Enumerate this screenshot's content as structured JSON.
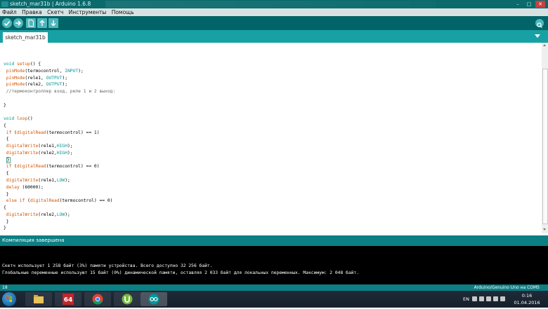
{
  "window": {
    "title": "sketch_mar31b | Arduino 1.6.8",
    "buttons": [
      "–",
      "□",
      "✕"
    ]
  },
  "menu": [
    "Файл",
    "Правка",
    "Скетч",
    "Инструменты",
    "Помощь"
  ],
  "toolbar": {
    "buttons": [
      "verify-icon",
      "upload-icon",
      "new-icon",
      "open-icon",
      "save-icon"
    ],
    "serial_monitor": "serial-monitor-icon"
  },
  "tabs": [
    {
      "label": "sketch_mar31b"
    }
  ],
  "editor": {
    "lines": [
      "void setup() {",
      " pinMode(termocontrol, INPUT);",
      " pinMode(rele1, OUTPUT);",
      " pinMode(rele2, OUTPUT);",
      " //термоконтроллер вход, реле 1 и 2 выход:",
      "",
      "}",
      "",
      "void loop()",
      "{",
      " if (digitalRead(termocontrol) == 1)",
      " {",
      " digitalWrite(rele1,HIGH);",
      " digitalWrite(rele2,HIGH);",
      " }",
      " if (digitalRead(termocontrol) == 0)",
      " {",
      " digitalWrite(rele1,LOW);",
      " delay (60000);",
      " }",
      " else if (digitalRead(termocontrol) == 0)",
      "{",
      " digitalWrite(rele2,LOW);",
      " }",
      "}"
    ]
  },
  "status": {
    "message": "Компиляция завершена"
  },
  "console": {
    "lines": [
      "Скетч использует 1 258 байт (3%) памяти устройства. Всего доступно 32 256 байт.",
      "Глобальные переменные используют 15 байт (0%) динамической памяти, оставляя 2 033 байт для локальных переменных. Максимум: 2 048 байт."
    ]
  },
  "infobar": {
    "line": "18",
    "board": "Arduino/Genuino Uno на COM5"
  },
  "taskbar": {
    "apps": [
      "explorer-icon",
      "aida64-icon",
      "chrome-icon",
      "utorrent-icon",
      "arduino-icon"
    ],
    "badge_64": "64",
    "language": "EN",
    "time": "0:16",
    "date": "01.04.2016"
  },
  "colors": {
    "teal_dark": "#006468",
    "teal_mid": "#17a1a5",
    "teal_status": "#0c7f84"
  }
}
